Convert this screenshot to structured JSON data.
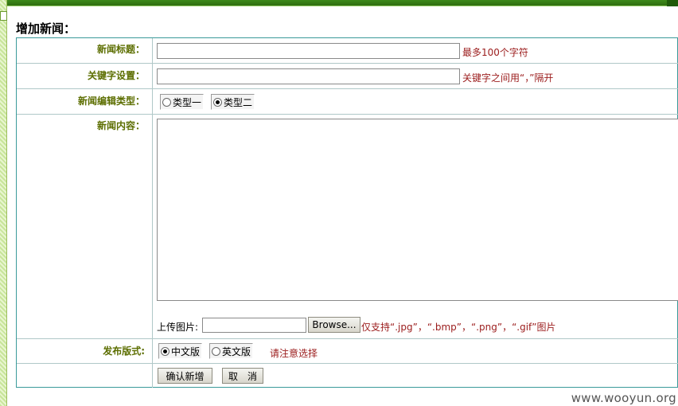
{
  "page": {
    "title": "增加新闻："
  },
  "form": {
    "title_row": {
      "label": "新闻标题：",
      "value": "",
      "hint": "最多100个字符"
    },
    "keywords_row": {
      "label": "关键字设置：",
      "value": "",
      "hint": "关键字之间用“，”隔开"
    },
    "type_row": {
      "label": "新闻编辑类型：",
      "options": [
        {
          "label": "类型一",
          "checked": false
        },
        {
          "label": "类型二",
          "checked": true
        }
      ]
    },
    "content_row": {
      "label": "新闻内容：",
      "upload_label": "上传图片:",
      "browse_label": "Browse...",
      "upload_hint": "仅支持“.jpg”，“.bmp”，“.png”，“.gif”图片"
    },
    "layout_row": {
      "label": "发布版式:",
      "options": [
        {
          "label": "中文版",
          "checked": true
        },
        {
          "label": "英文版",
          "checked": false
        }
      ],
      "hint": "请注意选择"
    },
    "actions": {
      "confirm_label": "确认新增",
      "cancel_label": "取　消"
    }
  },
  "watermark": "www.wooyun.org",
  "colors": {
    "label": "#5c6e00",
    "hint": "#9b1c1c",
    "border": "#3a9a9a",
    "top_bar": "#3d8a1a"
  }
}
